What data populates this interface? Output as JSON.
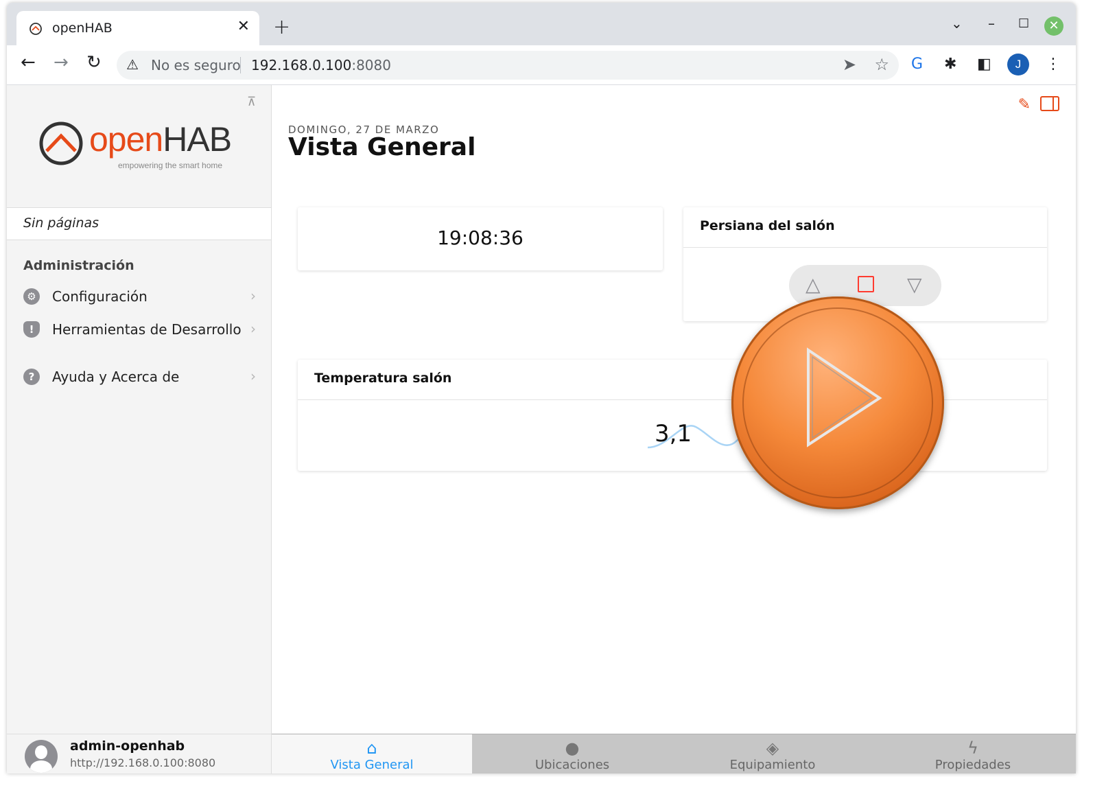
{
  "browser": {
    "tab_title": "openHAB",
    "tab_close": "✕",
    "new_tab": "+",
    "security_label": "No es seguro",
    "url_host": "192.168.0.100",
    "url_port": ":8080"
  },
  "sidebar": {
    "logo_word_open": "open",
    "logo_word_hab": "HAB",
    "logo_tagline": "empowering the smart home",
    "sin_paginas": "Sin páginas",
    "admin_section": "Administración",
    "items": [
      {
        "label": "Configuración",
        "icon": "gear-icon"
      },
      {
        "label": "Herramientas de Desarrollo",
        "icon": "shield-icon"
      },
      {
        "label": "Ayuda y Acerca de",
        "icon": "help-icon"
      }
    ],
    "user": {
      "name": "admin-openhab",
      "url": "http://192.168.0.100:8080"
    }
  },
  "main": {
    "date": "DOMINGO, 27 DE MARZO",
    "title": "Vista General",
    "clock": "19:08:36",
    "persiana_title": "Persiana del salón",
    "temperatura_title": "Temperatura salón",
    "temperatura_value": "3,1"
  },
  "tabbar": [
    {
      "label": "Vista General",
      "icon": "home-icon",
      "active": true
    },
    {
      "label": "Ubicaciones",
      "icon": "location-pin-icon",
      "active": false
    },
    {
      "label": "Equipamiento",
      "icon": "cube-icon",
      "active": false
    },
    {
      "label": "Propiedades",
      "icon": "bolt-icon",
      "active": false
    }
  ],
  "colors": {
    "accent": "#e64a19",
    "active_tab": "#2196f3",
    "stop_button": "#ff3b30",
    "play_overlay": "#f5893a"
  }
}
